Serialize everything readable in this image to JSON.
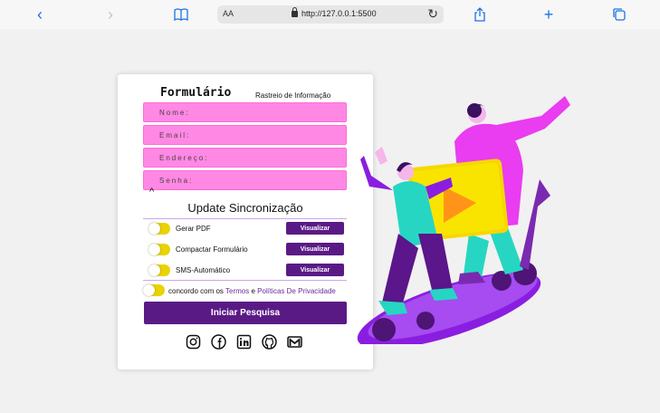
{
  "browser": {
    "url": "http://127.0.0.1:5500",
    "aa_label": "AA",
    "icons": [
      "back-icon",
      "forward-icon",
      "bookmarks-icon",
      "reload-icon",
      "share-icon",
      "new-tab-icon",
      "tabs-icon"
    ]
  },
  "form": {
    "title": "Formulário",
    "subtitle": "Rastreio de Informação",
    "fields": [
      {
        "placeholder": "Nome:",
        "value": ""
      },
      {
        "placeholder": "Email:",
        "value": ""
      },
      {
        "placeholder": "Endereço:",
        "value": ""
      },
      {
        "placeholder": "Senha:",
        "value": ""
      }
    ],
    "caret": "^",
    "sync_title": "Update Sincronização",
    "options": [
      {
        "label": "Gerar PDF",
        "button": "Visualizar"
      },
      {
        "label": "Compactar Formulário",
        "button": "Visualizar"
      },
      {
        "label": "SMS-Automático",
        "button": "Visualizar"
      }
    ],
    "agree": {
      "prefix": "concordo com os",
      "terms": "Termos",
      "conjunction": "e",
      "policies": "Políticas De Privacidade"
    },
    "submit": "Iniciar Pesquisa",
    "socials": [
      "instagram-icon",
      "facebook-icon",
      "linkedin-icon",
      "github-icon",
      "gmail-icon"
    ]
  },
  "colors": {
    "field": "#ff88e4",
    "button": "#5a1a86",
    "toggle": "#e9d300",
    "link": "#6a2a9e"
  }
}
